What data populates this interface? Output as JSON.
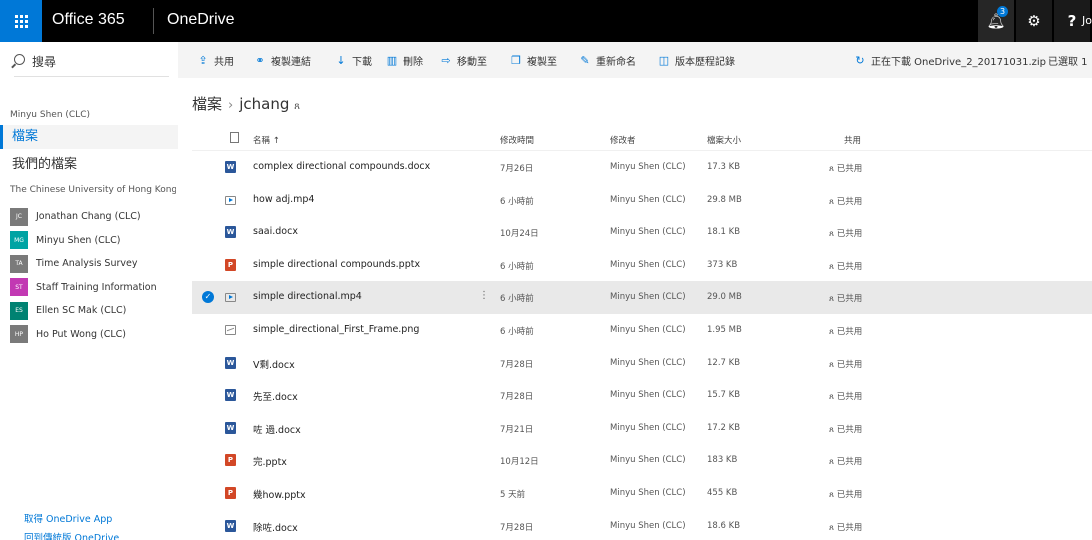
{
  "topbar": {
    "suite_name": "Office 365",
    "app_name": "OneDrive",
    "notification_count": "3",
    "help_label": "?",
    "user_initials": "Jo"
  },
  "left": {
    "search_placeholder": "搜尋",
    "owner": "Minyu Shen (CLC)",
    "nav_files": "檔案",
    "nav_mine": "我們的檔案",
    "org": "The Chinese University of Hong Kong",
    "shared": [
      {
        "initials": "JC",
        "name": "Jonathan Chang (CLC)",
        "color": "#7a7a7a"
      },
      {
        "initials": "MG",
        "name": "Minyu Shen (CLC)",
        "color": "#00a3a3"
      },
      {
        "initials": "TA",
        "name": "Time Analysis Survey",
        "color": "#7a7a7a"
      },
      {
        "initials": "ST",
        "name": "Staff Training Information",
        "color": "#c239b3"
      },
      {
        "initials": "ES",
        "name": "Ellen SC Mak (CLC)",
        "color": "#008272"
      },
      {
        "initials": "HP",
        "name": "Ho Put Wong (CLC)",
        "color": "#7a7a7a"
      }
    ],
    "get_app": "取得 OneDrive App",
    "classic": "回到傳統版 OneDrive"
  },
  "commands": {
    "share": "共用",
    "copy_link": "複製連結",
    "download": "下載",
    "delete": "刪除",
    "move_to": "移動至",
    "copy_to": "複製至",
    "rename": "重新命名",
    "version_history": "版本歷程記錄",
    "downloading": "正在下載 OneDrive_2_20171031.zip",
    "selected": "已選取 1"
  },
  "breadcrumb": {
    "root": "檔案",
    "folder": "jchang"
  },
  "columns": {
    "name": "名稱 ↑",
    "modified": "修改時間",
    "modified_by": "修改者",
    "size": "檔案大小",
    "sharing": "共用"
  },
  "files": [
    {
      "name": "complex directional compounds.docx",
      "type": "docx",
      "modified": "7月26日",
      "by": "Minyu Shen (CLC)",
      "size": "17.3 KB",
      "sharing": "已共用"
    },
    {
      "name": "how adj.mp4",
      "type": "mp4",
      "modified": "6 小時前",
      "by": "Minyu Shen (CLC)",
      "size": "29.8 MB",
      "sharing": "已共用"
    },
    {
      "name": "saai.docx",
      "type": "docx",
      "modified": "10月24日",
      "by": "Minyu Shen (CLC)",
      "size": "18.1 KB",
      "sharing": "已共用"
    },
    {
      "name": "simple directional compounds.pptx",
      "type": "pptx",
      "modified": "6 小時前",
      "by": "Minyu Shen (CLC)",
      "size": "373 KB",
      "sharing": "已共用"
    },
    {
      "name": "simple directional.mp4",
      "type": "mp4",
      "modified": "6 小時前",
      "by": "Minyu Shen (CLC)",
      "size": "29.0 MB",
      "sharing": "已共用",
      "selected": true
    },
    {
      "name": "simple_directional_First_Frame.png",
      "type": "png",
      "modified": "6 小時前",
      "by": "Minyu Shen (CLC)",
      "size": "1.95 MB",
      "sharing": "已共用"
    },
    {
      "name": "V剩.docx",
      "type": "docx",
      "modified": "7月28日",
      "by": "Minyu Shen (CLC)",
      "size": "12.7 KB",
      "sharing": "已共用"
    },
    {
      "name": "先至.docx",
      "type": "docx",
      "modified": "7月28日",
      "by": "Minyu Shen (CLC)",
      "size": "15.7 KB",
      "sharing": "已共用"
    },
    {
      "name": "咗 過.docx",
      "type": "docx",
      "modified": "7月21日",
      "by": "Minyu Shen (CLC)",
      "size": "17.2 KB",
      "sharing": "已共用"
    },
    {
      "name": "完.pptx",
      "type": "pptx",
      "modified": "10月12日",
      "by": "Minyu Shen (CLC)",
      "size": "183 KB",
      "sharing": "已共用"
    },
    {
      "name": "幾how.pptx",
      "type": "pptx",
      "modified": "5 天前",
      "by": "Minyu Shen (CLC)",
      "size": "455 KB",
      "sharing": "已共用"
    },
    {
      "name": "除咗.docx",
      "type": "docx",
      "modified": "7月28日",
      "by": "Minyu Shen (CLC)",
      "size": "18.6 KB",
      "sharing": "已共用"
    }
  ],
  "colors": {
    "accent": "#0078d7",
    "topbar": "#000000",
    "word": "#2b579a",
    "powerpoint": "#d24726",
    "selected_row": "#e9e9e9"
  }
}
